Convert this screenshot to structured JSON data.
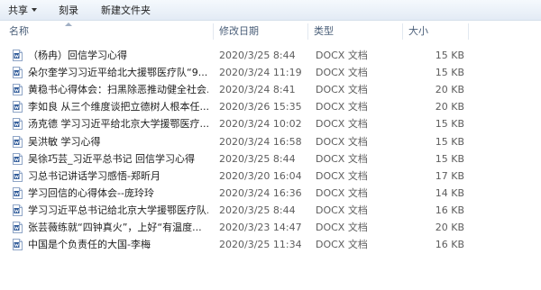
{
  "toolbar": {
    "share_label": "共享",
    "burn_label": "刻录",
    "new_folder_label": "新建文件夹"
  },
  "columns": {
    "name": "名称",
    "date": "修改日期",
    "type": "类型",
    "size": "大小"
  },
  "files": [
    {
      "name": "（杨冉）回信学习心得",
      "date": "2020/3/25 8:44",
      "type": "DOCX 文档",
      "size": "15 KB"
    },
    {
      "name": "朵尔奎学习习近平给北大援鄂医疗队“9...",
      "date": "2020/3/24 11:19",
      "type": "DOCX 文档",
      "size": "15 KB"
    },
    {
      "name": "黄稳书心得体会：扫黑除恶推动健全社会...",
      "date": "2020/3/24 8:41",
      "type": "DOCX 文档",
      "size": "20 KB"
    },
    {
      "name": "李如良 从三个维度谈把立德树人根本任...",
      "date": "2020/3/26 15:35",
      "type": "DOCX 文档",
      "size": "20 KB"
    },
    {
      "name": "汤克德 学习习近平给北京大学援鄂医疗...",
      "date": "2020/3/24 10:02",
      "type": "DOCX 文档",
      "size": "15 KB"
    },
    {
      "name": "吴洪敏 学习心得",
      "date": "2020/3/24 16:58",
      "type": "DOCX 文档",
      "size": "15 KB"
    },
    {
      "name": "吴徐巧芸_习近平总书记 回信学习心得",
      "date": "2020/3/25 8:44",
      "type": "DOCX 文档",
      "size": "15 KB"
    },
    {
      "name": "习总书记讲话学习感悟-郑昕月",
      "date": "2020/3/20 16:04",
      "type": "DOCX 文档",
      "size": "17 KB"
    },
    {
      "name": "学习回信的心得体会--庞玲玲",
      "date": "2020/3/24 16:36",
      "type": "DOCX 文档",
      "size": "14 KB"
    },
    {
      "name": "学习习近平总书记给北京大学援鄂医疗队...",
      "date": "2020/3/25 8:44",
      "type": "DOCX 文档",
      "size": "16 KB"
    },
    {
      "name": "张芸薇练就“四钟真火”，上好“有温度...",
      "date": "2020/3/23 14:47",
      "type": "DOCX 文档",
      "size": "20 KB"
    },
    {
      "name": "中国是个负责任的大国-李梅",
      "date": "2020/3/25 11:34",
      "type": "DOCX 文档",
      "size": "16 KB"
    }
  ],
  "icons": {
    "file_icon": "word-document-icon",
    "share_caret": "chevron-down-icon",
    "sort_indicator": "sort-ascending-icon"
  }
}
